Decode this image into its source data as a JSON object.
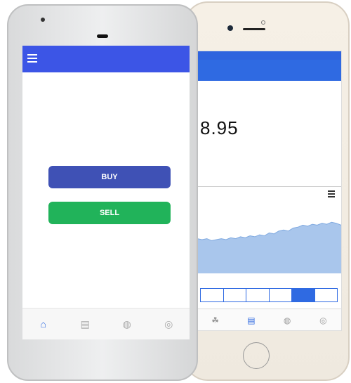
{
  "back_phone": {
    "status": {
      "left": "",
      "center": "",
      "right": ""
    },
    "header_title": "",
    "ticker": "",
    "ticker_sub": "",
    "price": "8.95",
    "price_sub": "",
    "volume": "",
    "volume_sub": "",
    "axis_labels": [
      "",
      "",
      "",
      ""
    ],
    "ranges": [
      "",
      "",
      "",
      "",
      "",
      ""
    ],
    "active_range_index": 4,
    "tabs": [
      {
        "icon": "leaf-icon",
        "label": ""
      },
      {
        "icon": "portfolio-icon",
        "label": ""
      },
      {
        "icon": "globe-icon",
        "label": ""
      },
      {
        "icon": "settings-icon",
        "label": ""
      }
    ],
    "active_tab_index": 1
  },
  "front_phone": {
    "app_title": "",
    "buy_label": "BUY",
    "sell_label": "SELL",
    "tabs": [
      {
        "icon": "home-icon",
        "label": ""
      },
      {
        "icon": "portfolio-icon",
        "label": ""
      },
      {
        "icon": "globe-icon",
        "label": ""
      },
      {
        "icon": "settings-icon",
        "label": ""
      }
    ],
    "active_tab_index": 0
  },
  "colors": {
    "app_bar": "#3c55e6",
    "buy": "#3f51b5",
    "sell": "#21b35a",
    "accent": "#2f6ae2",
    "chart_fill": "#a9c6ec"
  },
  "chart_data": {
    "type": "area",
    "title": "",
    "xlabel": "",
    "ylabel": "",
    "x": [
      0,
      1,
      2,
      3,
      4,
      5,
      6,
      7,
      8,
      9,
      10,
      11,
      12,
      13,
      14,
      15,
      16,
      17,
      18,
      19,
      20,
      21,
      22,
      23,
      24,
      25,
      26,
      27,
      28,
      29,
      30
    ],
    "y": [
      36,
      35,
      36,
      34,
      35,
      36,
      35,
      37,
      36,
      38,
      37,
      39,
      38,
      40,
      39,
      42,
      41,
      44,
      45,
      44,
      47,
      48,
      50,
      49,
      51,
      50,
      52,
      51,
      53,
      52,
      50
    ],
    "ylim": [
      0,
      70
    ],
    "grid": false,
    "legend": "none"
  }
}
